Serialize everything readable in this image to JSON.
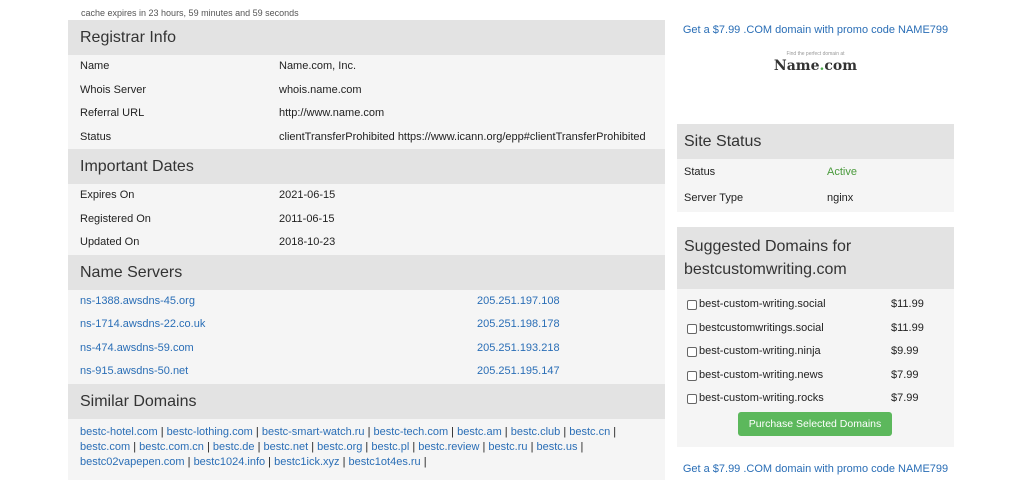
{
  "cache_notice": "cache expires in 23 hours, 59 minutes and 59 seconds",
  "registrar": {
    "title": "Registrar Info",
    "rows": [
      {
        "label": "Name",
        "value": "Name.com, Inc."
      },
      {
        "label": "Whois Server",
        "value": "whois.name.com"
      },
      {
        "label": "Referral URL",
        "value": "http://www.name.com"
      },
      {
        "label": "Status",
        "value": "clientTransferProhibited https://www.icann.org/epp#clientTransferProhibited"
      }
    ]
  },
  "dates": {
    "title": "Important Dates",
    "rows": [
      {
        "label": "Expires On",
        "value": "2021-06-15"
      },
      {
        "label": "Registered On",
        "value": "2011-06-15"
      },
      {
        "label": "Updated On",
        "value": "2018-10-23"
      }
    ]
  },
  "nameservers": {
    "title": "Name Servers",
    "rows": [
      {
        "host": "ns-1388.awsdns-45.org",
        "ip": "205.251.197.108"
      },
      {
        "host": "ns-1714.awsdns-22.co.uk",
        "ip": "205.251.198.178"
      },
      {
        "host": "ns-474.awsdns-59.com",
        "ip": "205.251.193.218"
      },
      {
        "host": "ns-915.awsdns-50.net",
        "ip": "205.251.195.147"
      }
    ]
  },
  "similar": {
    "title": "Similar Domains",
    "domains": [
      "bestc-hotel.com",
      "bestc-lothing.com",
      "bestc-smart-watch.ru",
      "bestc-tech.com",
      "bestc.am",
      "bestc.club",
      "bestc.cn",
      "bestc.com",
      "bestc.com.cn",
      "bestc.de",
      "bestc.net",
      "bestc.org",
      "bestc.pl",
      "bestc.review",
      "bestc.ru",
      "bestc.us",
      "bestc02vapepen.com",
      "bestc1024.info",
      "bestc1ick.xyz",
      "bestc1ot4es.ru"
    ]
  },
  "promo_text": "Get a $7.99 .COM domain with promo code NAME799",
  "logo": {
    "tagline": "Find the perfect domain at",
    "name_a": "Name",
    "dot": ".",
    "name_b": "com"
  },
  "site_status": {
    "title": "Site Status",
    "status_label": "Status",
    "status_value": "Active",
    "server_label": "Server Type",
    "server_value": "nginx"
  },
  "suggested": {
    "title": "Suggested Domains for bestcustomwriting.com",
    "items": [
      {
        "name": "best-custom-writing.social",
        "price": "$11.99"
      },
      {
        "name": "bestcustomwritings.social",
        "price": "$11.99"
      },
      {
        "name": "best-custom-writing.ninja",
        "price": "$9.99"
      },
      {
        "name": "best-custom-writing.news",
        "price": "$7.99"
      },
      {
        "name": "best-custom-writing.rocks",
        "price": "$7.99"
      }
    ],
    "button": "Purchase Selected Domains"
  },
  "colors": {
    "link": "#2a6eb6",
    "active": "#4a9a3c",
    "button": "#5cb85c",
    "section_header": "#e3e3e3",
    "panel": "#f5f5f5"
  }
}
